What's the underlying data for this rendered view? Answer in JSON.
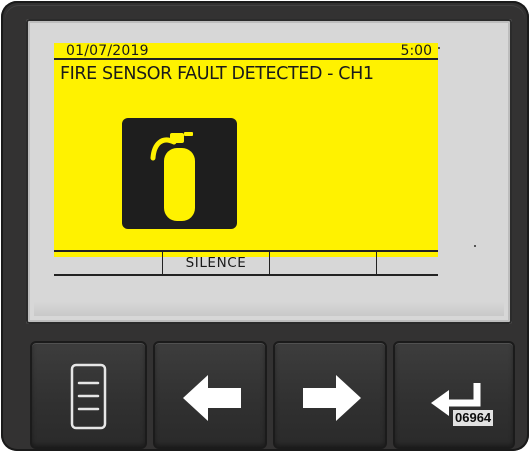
{
  "display": {
    "date": "01/07/2019",
    "time": "5:00",
    "message": "FIRE SENSOR FAULT DETECTED  - CH1",
    "alarm_icon": "fire-extinguisher-icon",
    "background_color": "#fff200",
    "softkeys": [
      "",
      "SILENCE",
      "",
      ""
    ]
  },
  "buttons": [
    {
      "name": "menu",
      "icon": "menu-list-icon"
    },
    {
      "name": "left",
      "icon": "arrow-left-icon"
    },
    {
      "name": "right",
      "icon": "arrow-right-icon"
    },
    {
      "name": "enter",
      "icon": "enter-return-icon"
    }
  ],
  "part_number": "06964"
}
